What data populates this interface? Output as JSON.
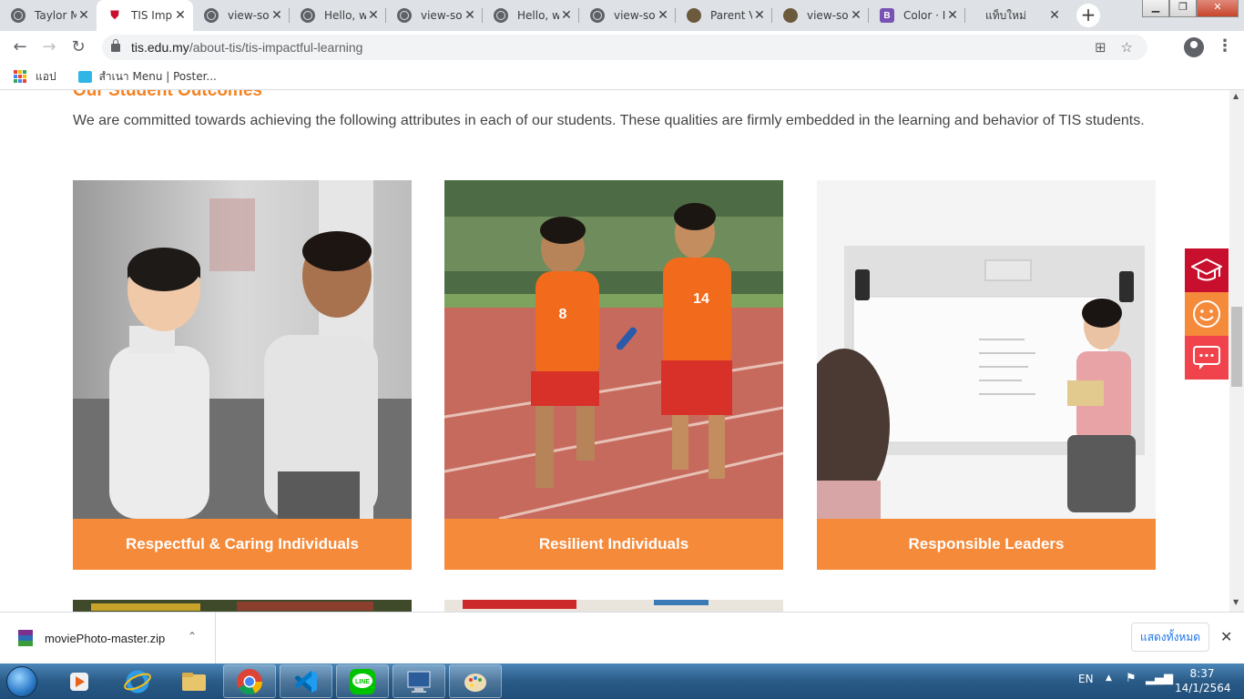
{
  "tabs": [
    {
      "title": "Taylor M",
      "icon": "globe"
    },
    {
      "title": "TIS Imp",
      "icon": "tis",
      "active": true
    },
    {
      "title": "view-so",
      "icon": "globe"
    },
    {
      "title": "Hello, w",
      "icon": "globe"
    },
    {
      "title": "view-so",
      "icon": "globe"
    },
    {
      "title": "Hello, w",
      "icon": "globe"
    },
    {
      "title": "view-so",
      "icon": "globe"
    },
    {
      "title": "Parent V",
      "icon": "owl"
    },
    {
      "title": "view-so",
      "icon": "owl"
    },
    {
      "title": "Color · I",
      "icon": "bootstrap"
    },
    {
      "title": "แท็บใหม่",
      "icon": "blank"
    }
  ],
  "new_tab_label": "+",
  "bootstrap_letter": "B",
  "address": {
    "domain": "tis.edu.my",
    "path": "/about-tis/tis-impactful-learning"
  },
  "bookmarks": [
    {
      "label": "แอป"
    },
    {
      "label": "สำเนา Menu | Poster..."
    }
  ],
  "page": {
    "section_title": "Our Student Outcomes",
    "intro": "We are committed towards achieving the following attributes in each of our students. These qualities are firmly embedded in the learning and behavior of TIS students.",
    "cards": [
      {
        "caption": "Respectful & Caring Individuals"
      },
      {
        "caption": "Resilient Individuals"
      },
      {
        "caption": "Responsible Leaders"
      }
    ],
    "jersey_numbers": [
      "8",
      "14"
    ]
  },
  "download": {
    "filename": "moviePhoto-master.zip",
    "show_all": "แสดงทั้งหมด"
  },
  "taskbar": {
    "language": "EN",
    "time": "8:37",
    "date": "14/1/2564"
  },
  "colors": {
    "accent": "#f58a3a",
    "title": "#f58220",
    "side_red": "#c8102e"
  }
}
